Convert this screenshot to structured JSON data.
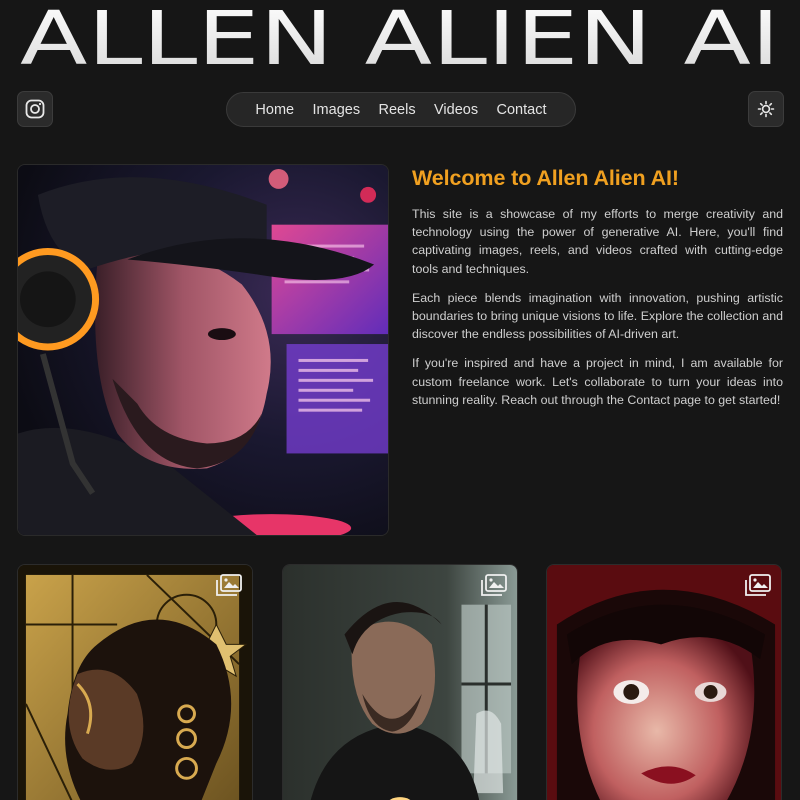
{
  "header": {
    "site_title": "ALLEN ALIEN AI"
  },
  "topbar": {
    "instagram_icon": "instagram-icon",
    "theme_icon": "sun-icon"
  },
  "nav": {
    "items": [
      {
        "label": "Home"
      },
      {
        "label": "Images"
      },
      {
        "label": "Reels"
      },
      {
        "label": "Videos"
      },
      {
        "label": "Contact"
      }
    ]
  },
  "hero": {
    "title": "Welcome to Allen Alien AI!",
    "paragraphs": [
      "This site is a showcase of my efforts to merge creativity and technology using the power of generative AI. Here, you'll find captivating images, reels, and videos crafted with cutting-edge tools and techniques.",
      "Each piece blends imagination with innovation, pushing artistic boundaries to bring unique visions to life. Explore the collection and discover the endless possibilities of AI-driven art.",
      "If you're inspired and have a project in mind, I am available for custom freelance work. Let's collaborate to turn your ideas into stunning reality. Reach out through the Contact page to get started!"
    ]
  },
  "gallery": {
    "badge_icon": "image-icon",
    "items": [
      {
        "subject": "gold-portrait"
      },
      {
        "subject": "man-haunted-room"
      },
      {
        "subject": "woman-red-light"
      }
    ]
  },
  "colors": {
    "background": "#161616",
    "accent": "#f0a020",
    "text": "#cfcfcf"
  }
}
